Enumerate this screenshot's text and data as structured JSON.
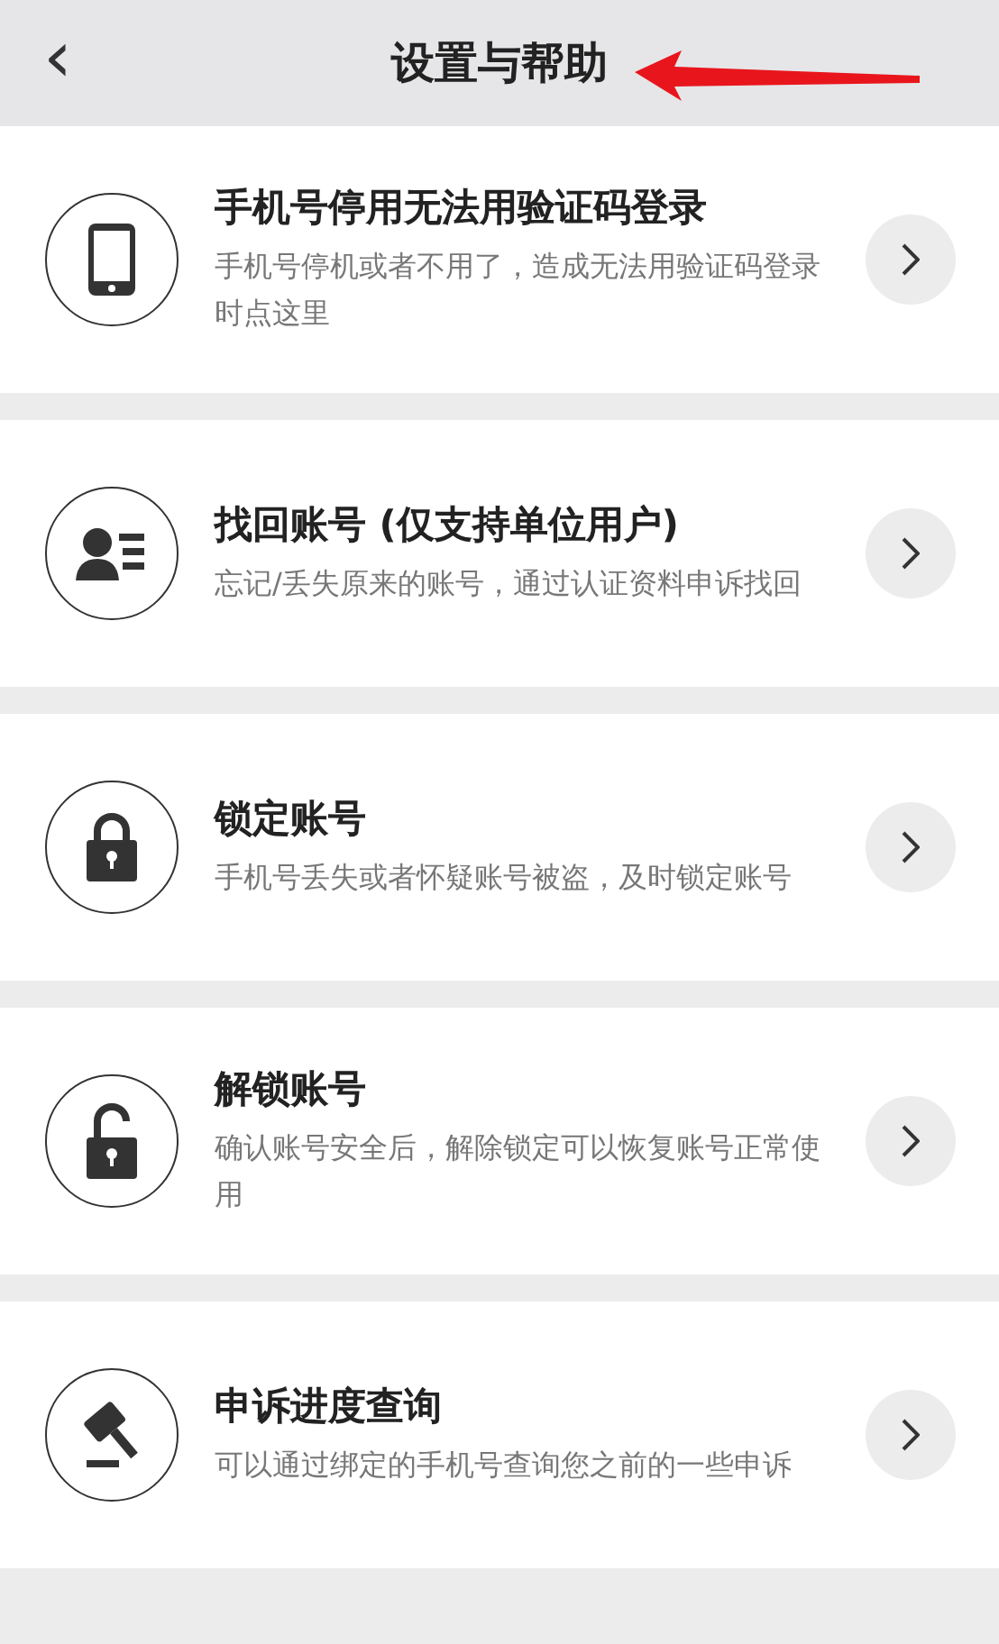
{
  "header": {
    "back_icon": "‹",
    "title": "设置与帮助"
  },
  "items": [
    {
      "kind": "phone",
      "title": "手机号停用无法用验证码登录",
      "description": "手机号停机或者不用了，造成无法用验证码登录时点这里"
    },
    {
      "kind": "account",
      "title": "找回账号 (仅支持单位用户)",
      "description": "忘记/丢失原来的账号，通过认证资料申诉找回"
    },
    {
      "kind": "lock",
      "title": "锁定账号",
      "description": "手机号丢失或者怀疑账号被盗，及时锁定账号"
    },
    {
      "kind": "unlock",
      "title": "解锁账号",
      "description": "确认账号安全后，解除锁定可以恢复账号正常使用"
    },
    {
      "kind": "gavel",
      "title": "申诉进度查询",
      "description": "可以通过绑定的手机号查询您之前的一些申诉"
    }
  ]
}
